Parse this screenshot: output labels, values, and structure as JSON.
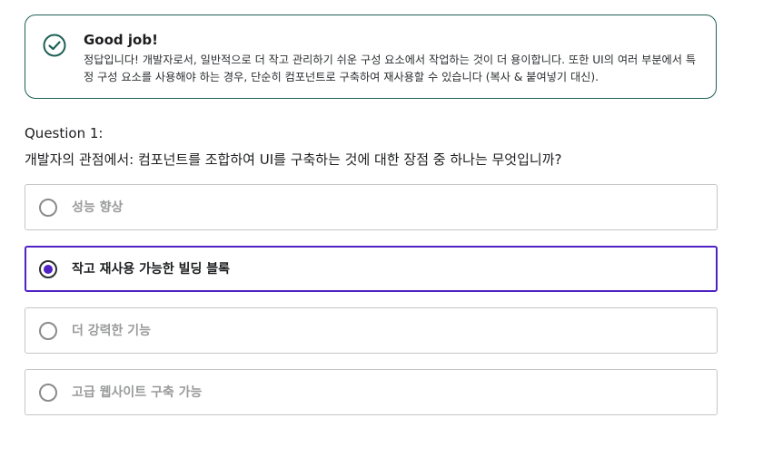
{
  "feedback": {
    "icon": "check-circle-icon",
    "accent_color": "#1e6055",
    "title": "Good job!",
    "body": "정답입니다! 개발자로서, 일반적으로 더 작고 관리하기 쉬운 구성 요소에서 작업하는 것이 더 용이합니다. 또한 UI의 여러 부분에서 특정 구성 요소를 사용해야 하는 경우, 단순히 컴포넌트로 구축하여 재사용할 수 있습니다 (복사 & 붙여넣기 대신)."
  },
  "question": {
    "number_label": "Question 1:",
    "text": "개발자의 관점에서: 컴포넌트를 조합하여 UI를 구축하는 것에 대한 장점 중 하나는 무엇입니까?"
  },
  "options": [
    {
      "label": "성능 향상",
      "selected": false
    },
    {
      "label": "작고 재사용 가능한 빌딩 블록",
      "selected": true
    },
    {
      "label": "더 강력한 기능",
      "selected": false
    },
    {
      "label": "고급 웹사이트 구축 가능",
      "selected": false
    }
  ],
  "colors": {
    "selected_accent": "#5022c3",
    "border_default": "#c6c6c6"
  }
}
